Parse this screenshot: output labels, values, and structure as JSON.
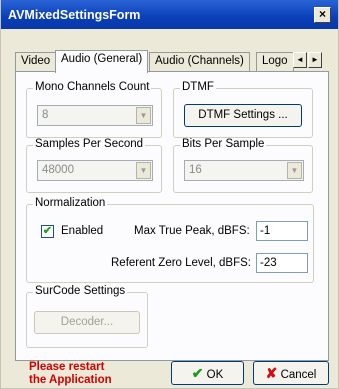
{
  "window": {
    "title": "AVMixedSettingsForm",
    "close_glyph": "×"
  },
  "tabs": [
    {
      "label": "Video"
    },
    {
      "label": "Audio (General)"
    },
    {
      "label": "Audio (Channels)"
    },
    {
      "label": "Logo"
    }
  ],
  "tab_scroll": {
    "left": "◄",
    "right": "►"
  },
  "mono_channels": {
    "legend": "Mono Channels Count",
    "value": "8"
  },
  "dtmf": {
    "legend": "DTMF",
    "button": "DTMF Settings ..."
  },
  "samples": {
    "legend": "Samples Per Second",
    "value": "48000"
  },
  "bits": {
    "legend": "Bits Per Sample",
    "value": "16"
  },
  "normalization": {
    "legend": "Normalization",
    "enabled_label": "Enabled",
    "enabled": true,
    "checkmark": "✔",
    "max_peak_label": "Max True Peak, dBFS:",
    "max_peak_value": "-1",
    "ref_zero_label": "Referent Zero Level, dBFS:",
    "ref_zero_value": "-23"
  },
  "surcode": {
    "legend": "SurCode Settings",
    "button": "Decoder..."
  },
  "footer": {
    "warning_line1": "Please restart",
    "warning_line2": "the Application",
    "ok_label": "OK",
    "ok_icon": "✔",
    "cancel_label": "Cancel",
    "cancel_icon": "✘"
  },
  "dropdown_glyph": "▼"
}
